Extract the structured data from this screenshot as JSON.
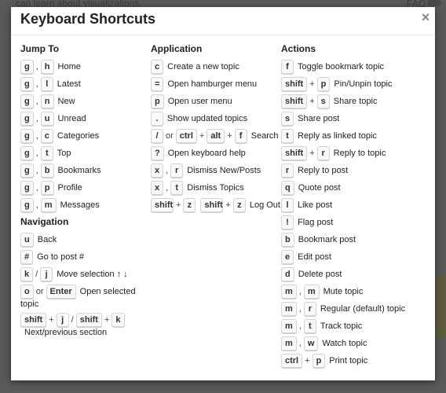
{
  "background": {
    "top_text": "can learn about visualizations.",
    "faq": "FAQ"
  },
  "modal": {
    "title": "Keyboard Shortcuts",
    "close": "×"
  },
  "jump_to": {
    "heading": "Jump To",
    "items": [
      {
        "keys": [
          "g",
          "h"
        ],
        "seps": [
          ","
        ],
        "desc": "Home"
      },
      {
        "keys": [
          "g",
          "l"
        ],
        "seps": [
          ","
        ],
        "desc": "Latest"
      },
      {
        "keys": [
          "g",
          "n"
        ],
        "seps": [
          ","
        ],
        "desc": "New"
      },
      {
        "keys": [
          "g",
          "u"
        ],
        "seps": [
          ","
        ],
        "desc": "Unread"
      },
      {
        "keys": [
          "g",
          "c"
        ],
        "seps": [
          ","
        ],
        "desc": "Categories"
      },
      {
        "keys": [
          "g",
          "t"
        ],
        "seps": [
          ","
        ],
        "desc": "Top"
      },
      {
        "keys": [
          "g",
          "b"
        ],
        "seps": [
          ","
        ],
        "desc": "Bookmarks"
      },
      {
        "keys": [
          "g",
          "p"
        ],
        "seps": [
          ","
        ],
        "desc": "Profile"
      },
      {
        "keys": [
          "g",
          "m"
        ],
        "seps": [
          ","
        ],
        "desc": "Messages"
      }
    ]
  },
  "navigation": {
    "heading": "Navigation",
    "items": [
      {
        "keys": [
          "u"
        ],
        "seps": [],
        "desc": "Back"
      },
      {
        "keys": [
          "#"
        ],
        "seps": [],
        "desc": "Go to post #"
      },
      {
        "keys": [
          "k",
          "j"
        ],
        "seps": [
          "/"
        ],
        "desc": "Move selection ↑ ↓"
      },
      {
        "keys": [
          "o",
          "Enter"
        ],
        "seps": [
          "or"
        ],
        "desc": "Open selected topic",
        "wrap": true
      },
      {
        "keys": [
          "shift",
          "j",
          "shift",
          "k"
        ],
        "seps": [
          "+",
          "/",
          "+"
        ],
        "desc": "Next/previous section",
        "wrap": true
      }
    ]
  },
  "application": {
    "heading": "Application",
    "items": [
      {
        "keys": [
          "c"
        ],
        "seps": [],
        "desc": "Create a new topic"
      },
      {
        "keys": [
          "="
        ],
        "seps": [],
        "desc": "Open hamburger menu"
      },
      {
        "keys": [
          "p"
        ],
        "seps": [],
        "desc": "Open user menu"
      },
      {
        "keys": [
          "."
        ],
        "seps": [],
        "desc": "Show updated topics"
      },
      {
        "keys": [
          "/",
          "ctrl",
          "alt",
          "f"
        ],
        "seps": [
          "or",
          "+",
          "+"
        ],
        "desc": "Search"
      },
      {
        "keys": [
          "?"
        ],
        "seps": [],
        "desc": "Open keyboard help"
      },
      {
        "keys": [
          "x",
          "r"
        ],
        "seps": [
          ","
        ],
        "desc": "Dismiss New/Posts"
      },
      {
        "keys": [
          "x",
          "t"
        ],
        "seps": [
          ","
        ],
        "desc": "Dismiss Topics"
      },
      {
        "keys": [
          "shift",
          "z",
          "shift",
          "z"
        ],
        "seps": [
          "+",
          "",
          "+"
        ],
        "desc": "Log Out"
      }
    ]
  },
  "actions": {
    "heading": "Actions",
    "items": [
      {
        "keys": [
          "f"
        ],
        "seps": [],
        "desc": "Toggle bookmark topic"
      },
      {
        "keys": [
          "shift",
          "p"
        ],
        "seps": [
          "+"
        ],
        "desc": "Pin/Unpin topic"
      },
      {
        "keys": [
          "shift",
          "s"
        ],
        "seps": [
          "+"
        ],
        "desc": "Share topic"
      },
      {
        "keys": [
          "s"
        ],
        "seps": [],
        "desc": "Share post"
      },
      {
        "keys": [
          "t"
        ],
        "seps": [],
        "desc": "Reply as linked topic"
      },
      {
        "keys": [
          "shift",
          "r"
        ],
        "seps": [
          "+"
        ],
        "desc": "Reply to topic"
      },
      {
        "keys": [
          "r"
        ],
        "seps": [],
        "desc": "Reply to post"
      },
      {
        "keys": [
          "q"
        ],
        "seps": [],
        "desc": "Quote post"
      },
      {
        "keys": [
          "l"
        ],
        "seps": [],
        "desc": "Like post"
      },
      {
        "keys": [
          "!"
        ],
        "seps": [],
        "desc": "Flag post"
      },
      {
        "keys": [
          "b"
        ],
        "seps": [],
        "desc": "Bookmark post"
      },
      {
        "keys": [
          "e"
        ],
        "seps": [],
        "desc": "Edit post"
      },
      {
        "keys": [
          "d"
        ],
        "seps": [],
        "desc": "Delete post"
      },
      {
        "keys": [
          "m",
          "m"
        ],
        "seps": [
          ","
        ],
        "desc": "Mute topic"
      },
      {
        "keys": [
          "m",
          "r"
        ],
        "seps": [
          ","
        ],
        "desc": "Regular (default) topic"
      },
      {
        "keys": [
          "m",
          "t"
        ],
        "seps": [
          ","
        ],
        "desc": "Track topic"
      },
      {
        "keys": [
          "m",
          "w"
        ],
        "seps": [
          ","
        ],
        "desc": "Watch topic"
      },
      {
        "keys": [
          "ctrl",
          "p"
        ],
        "seps": [
          "+"
        ],
        "desc": "Print topic"
      }
    ]
  }
}
